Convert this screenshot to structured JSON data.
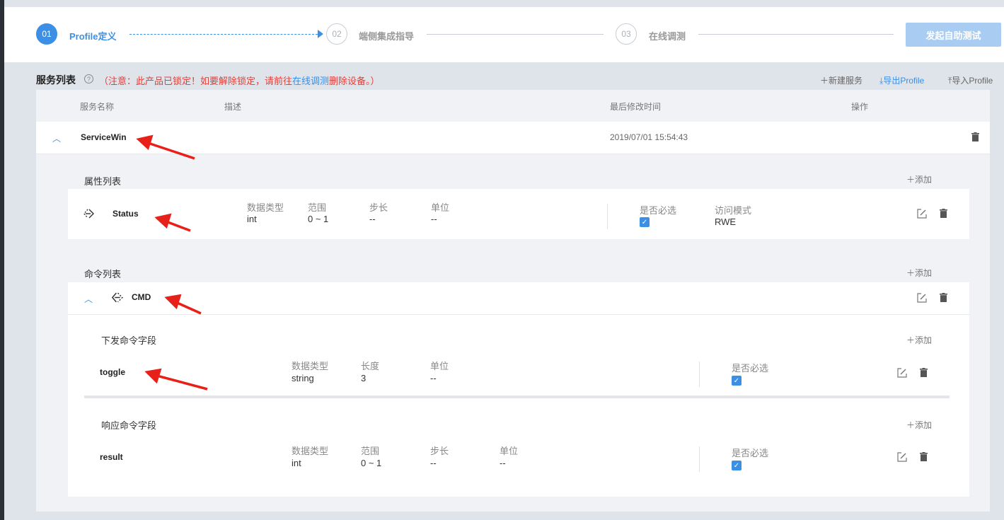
{
  "steps": [
    {
      "num": "01",
      "label": "Profile定义"
    },
    {
      "num": "02",
      "label": "端侧集成指导"
    },
    {
      "num": "03",
      "label": "在线调测"
    }
  ],
  "test_button": "发起自助测试",
  "service_list": {
    "title": "服务列表",
    "help": "?",
    "notice_prefix": "（注意：此产品已锁定！如要解除锁定，请前往",
    "notice_link": "在线调测",
    "notice_suffix": "删除设备。）",
    "actions": {
      "new_service": "＋新建服务",
      "export": "导出Profile",
      "import": "导入Profile"
    },
    "columns": {
      "name": "服务名称",
      "desc": "描述",
      "modified": "最后修改时间",
      "ops": "操作"
    }
  },
  "service": {
    "name": "ServiceWin",
    "modified": "2019/07/01 15:54:43"
  },
  "properties": {
    "title": "属性列表",
    "add": "＋添加",
    "item": {
      "name": "Status",
      "type_label": "数据类型",
      "type": "int",
      "range_label": "范围",
      "range": "0 ~ 1",
      "step_label": "步长",
      "step": "--",
      "unit_label": "单位",
      "unit": "--",
      "required_label": "是否必选",
      "access_label": "访问模式",
      "access": "RWE"
    }
  },
  "commands": {
    "title": "命令列表",
    "add": "＋添加",
    "cmd": {
      "name": "CMD",
      "down_title": "下发命令字段",
      "down_add": "＋添加",
      "down_field": {
        "name": "toggle",
        "type_label": "数据类型",
        "type": "string",
        "len_label": "长度",
        "len": "3",
        "unit_label": "单位",
        "unit": "--",
        "required_label": "是否必选"
      },
      "resp_title": "响应命令字段",
      "resp_add": "＋添加",
      "resp_field": {
        "name": "result",
        "type_label": "数据类型",
        "type": "int",
        "range_label": "范围",
        "range": "0 ~ 1",
        "step_label": "步长",
        "step": "--",
        "unit_label": "单位",
        "unit": "--",
        "required_label": "是否必选"
      }
    }
  },
  "colors": {
    "accent": "#3b8fe4",
    "notice": "#e0403a",
    "arrow": "#e8201a"
  }
}
